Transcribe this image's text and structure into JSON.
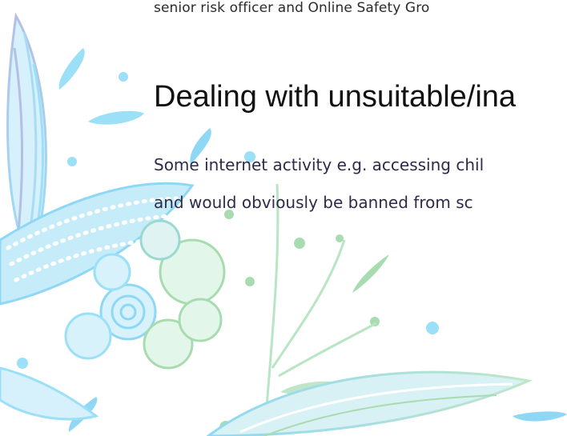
{
  "document": {
    "previous_line": "senior risk officer and Online Safety Gro",
    "heading": "Dealing with unsuitable/ina",
    "paragraph_lines": [
      "Some internet activity e.g. accessing chil",
      "and would obviously be banned from sc"
    ]
  },
  "decoration": {
    "style": "floral-botanical-line-art",
    "colors": {
      "light_blue": "#9be0f7",
      "sky_blue": "#7fd0f2",
      "lavender": "#b4bfe6",
      "mint": "#bfe6c8",
      "light_green": "#a8dcb0"
    }
  }
}
